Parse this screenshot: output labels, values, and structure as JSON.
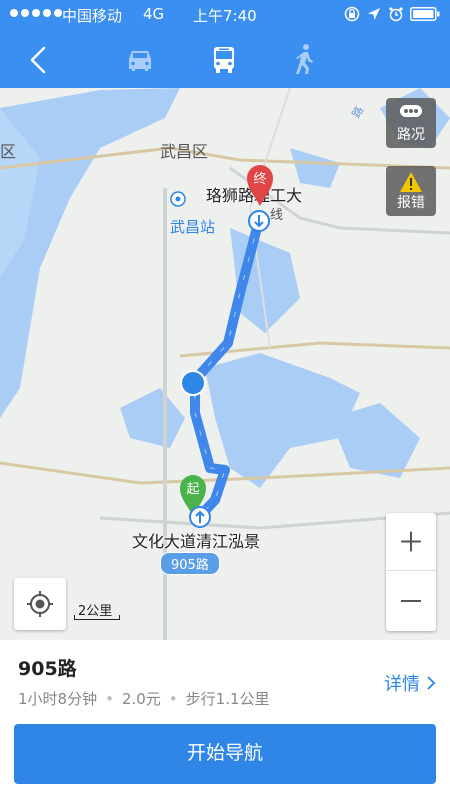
{
  "status_bar": {
    "carrier": "中国移动",
    "network": "4G",
    "time": "上午7:40"
  },
  "nav": {
    "modes": [
      "car",
      "bus",
      "walk"
    ],
    "active_mode": "bus"
  },
  "map": {
    "district_left": "区",
    "district_center": "武昌区",
    "station": "武昌站",
    "destination_label": "珞狮路理工大",
    "origin_label": "文化大道清江泓景",
    "start_marker": "起",
    "end_marker": "终",
    "road_label_1": "路",
    "road_label_2": "线",
    "route_badge": "905路",
    "traffic_label": "路况",
    "report_label": "报错",
    "scale_label": "2公里"
  },
  "panel": {
    "route_name": "905路",
    "duration": "1小时8分钟",
    "fare": "2.0元",
    "walk": "步行1.1公里",
    "detail_label": "详情",
    "start_button": "开始导航"
  },
  "colors": {
    "primary": "#3a8ff0",
    "button": "#2f86e6",
    "route": "#3f87ea",
    "water": "#aacdf5"
  }
}
